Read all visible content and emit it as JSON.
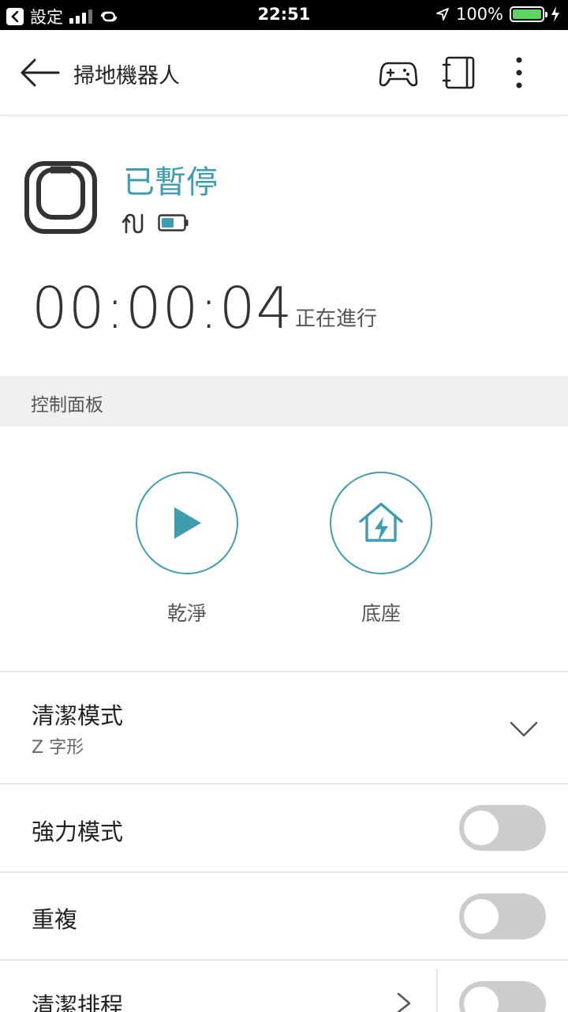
{
  "status_bar": {
    "back_app": "設定",
    "time": "22:51",
    "battery_percent": "100%",
    "battery_level": 1.0
  },
  "app_bar": {
    "title": "掃地機器人",
    "icons": [
      "back-arrow-icon",
      "gamepad-icon",
      "notebook-icon",
      "more-vert-icon"
    ]
  },
  "device": {
    "state": "已暫停",
    "timer": "00:00:04",
    "timer_label": "正在進行"
  },
  "control_panel": {
    "header": "控制面板",
    "clean_label": "乾淨",
    "dock_label": "底座"
  },
  "settings": {
    "clean_mode": {
      "title": "清潔模式",
      "value": "Z 字形"
    },
    "power_mode": {
      "title": "強力模式",
      "on": false
    },
    "repeat": {
      "title": "重複",
      "on": false
    },
    "schedule": {
      "title": "清潔排程",
      "on": false
    }
  },
  "colors": {
    "accent": "#3f9db1",
    "toggle_off": "#cccccc",
    "section_bg": "#f0f0f0"
  }
}
